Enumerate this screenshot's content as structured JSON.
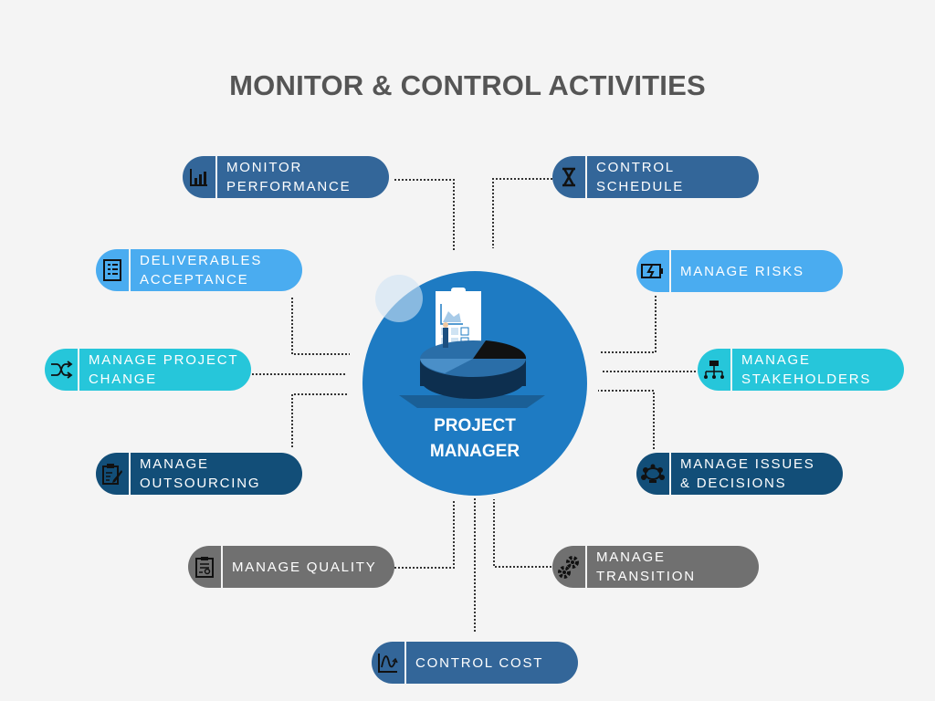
{
  "title": "MONITOR & CONTROL ACTIVITIES",
  "center": {
    "label": "PROJECT\nMANAGER",
    "color": "#1e7bc3"
  },
  "colors": {
    "dark_blue": "#336699",
    "light_blue": "#4aacf0",
    "cyan": "#26c6da",
    "navy": "#124e78",
    "gray": "#707070",
    "line": "#333333"
  },
  "nodes": [
    {
      "id": "monitor-performance",
      "label": "MONITOR\nPERFORMANCE",
      "icon": "bar-chart-icon",
      "color": "#336699"
    },
    {
      "id": "control-schedule",
      "label": "CONTROL\nSCHEDULE",
      "icon": "hourglass-icon",
      "color": "#336699"
    },
    {
      "id": "deliverables-acceptance",
      "label": "DELIVERABLES\nACCEPTANCE",
      "icon": "checklist-icon",
      "color": "#4aacf0"
    },
    {
      "id": "manage-risks",
      "label": "MANAGE RISKS",
      "icon": "battery-charge-icon",
      "color": "#4aacf0"
    },
    {
      "id": "manage-project-change",
      "label": "MANAGE PROJECT\nCHANGE",
      "icon": "shuffle-icon",
      "color": "#26c6da"
    },
    {
      "id": "manage-stakeholders",
      "label": "MANAGE\nSTAKEHOLDERS",
      "icon": "org-chart-icon",
      "color": "#26c6da"
    },
    {
      "id": "manage-outsourcing",
      "label": "MANAGE\nOUTSOURCING",
      "icon": "clipboard-edit-icon",
      "color": "#124e78"
    },
    {
      "id": "manage-issues-decisions",
      "label": "MANAGE ISSUES\n& DECISIONS",
      "icon": "meeting-table-icon",
      "color": "#124e78"
    },
    {
      "id": "manage-quality",
      "label": "MANAGE QUALITY",
      "icon": "certificate-clipboard-icon",
      "color": "#707070"
    },
    {
      "id": "manage-transition",
      "label": "MANAGE\nTRANSITION",
      "icon": "gears-icon",
      "color": "#707070"
    },
    {
      "id": "control-cost",
      "label": "CONTROL COST",
      "icon": "trend-curve-icon",
      "color": "#336699"
    }
  ]
}
